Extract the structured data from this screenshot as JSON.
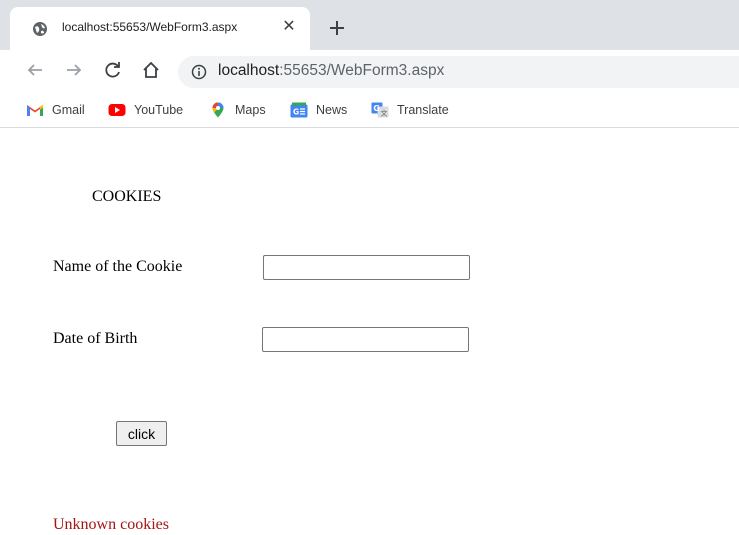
{
  "browser": {
    "tab": {
      "title": "localhost:55653/WebForm3.aspx",
      "favicon": "globe-icon",
      "close_glyph": "✕"
    },
    "new_tab_icon": "plus-icon",
    "nav": {
      "back": "arrow-left-icon",
      "forward": "arrow-right-icon",
      "reload": "reload-icon",
      "home": "home-icon"
    },
    "address": {
      "host": "localhost",
      "rest": ":55653/WebForm3.aspx",
      "info_icon": "info-icon"
    },
    "bookmarks": [
      {
        "label": "Gmail",
        "icon": "gmail-icon"
      },
      {
        "label": "YouTube",
        "icon": "youtube-icon"
      },
      {
        "label": "Maps",
        "icon": "maps-icon"
      },
      {
        "label": "News",
        "icon": "news-icon"
      },
      {
        "label": "Translate",
        "icon": "translate-icon"
      }
    ]
  },
  "page": {
    "heading": "COOKIES",
    "fields": [
      {
        "label": "Name of the Cookie",
        "value": ""
      },
      {
        "label": "Date of Birth",
        "value": ""
      }
    ],
    "button_label": "click",
    "status": "Unknown cookies"
  },
  "colors": {
    "status": "#a31515",
    "chrome": "#dee1e6",
    "omnibox": "#f1f3f4"
  }
}
